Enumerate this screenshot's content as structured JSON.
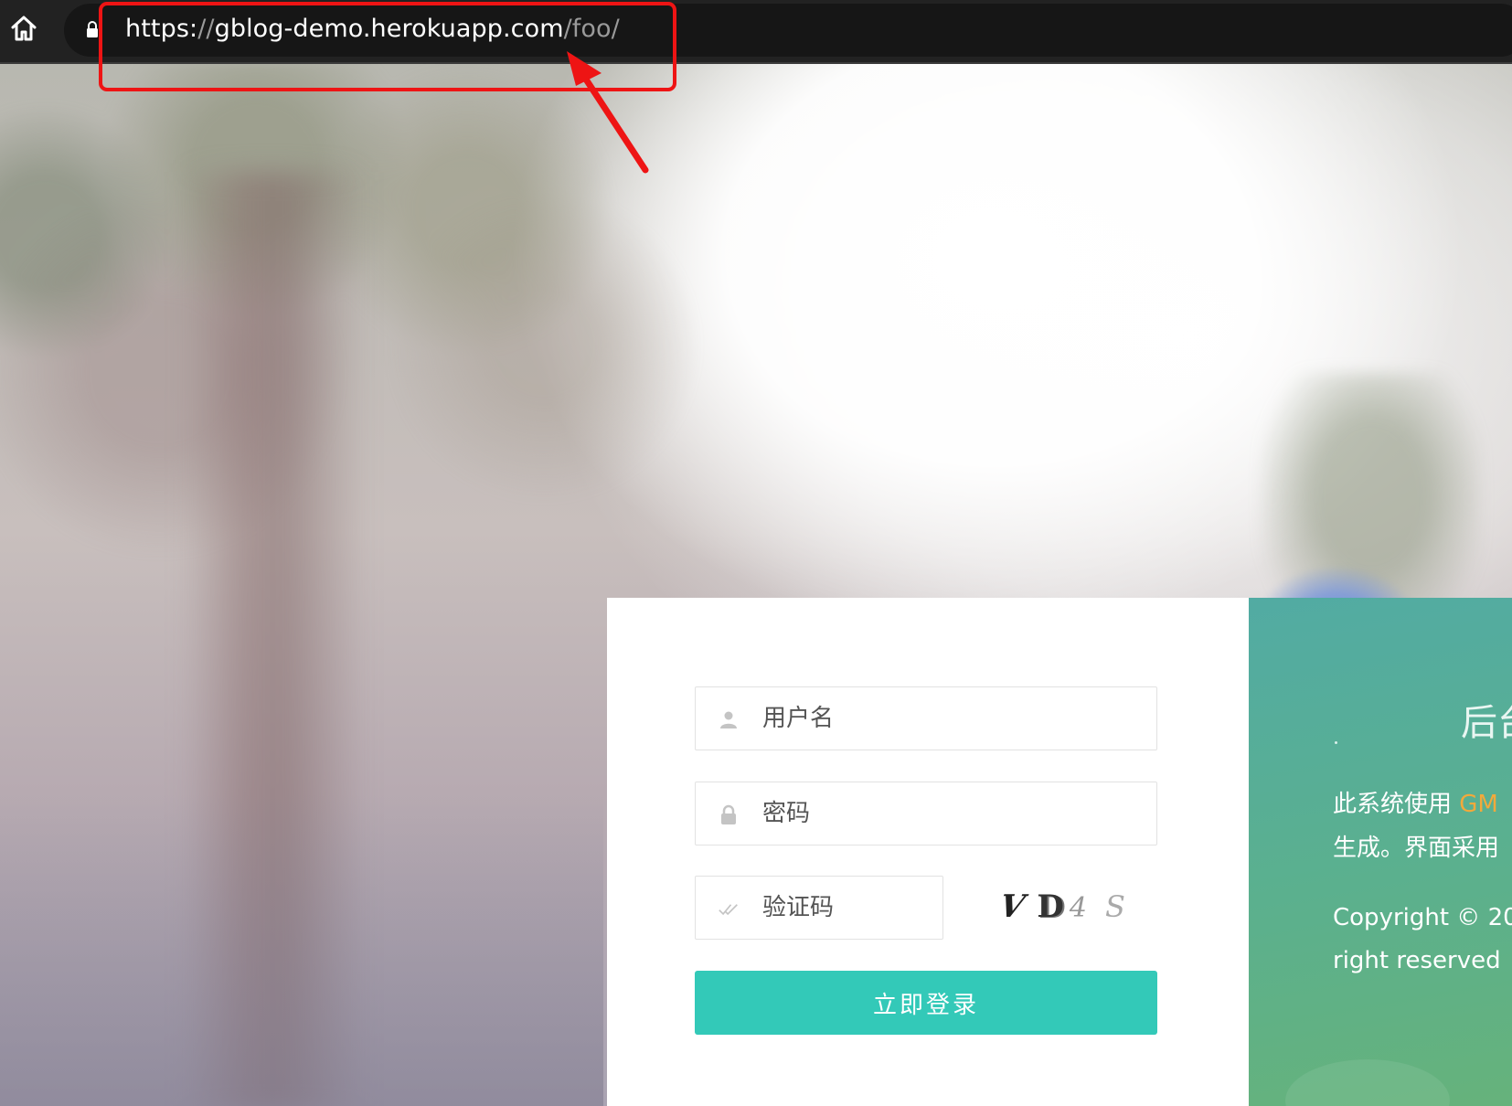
{
  "browser": {
    "url": {
      "scheme": "https:",
      "separator": "//",
      "host": "gblog-demo.herokuapp.com",
      "path": "/foo/"
    },
    "highlight_color": "#ee1414"
  },
  "login": {
    "username_placeholder": "用户名",
    "password_placeholder": "密码",
    "captcha_placeholder": "验证码",
    "captcha_chars": [
      "V",
      "D",
      "4",
      "S"
    ],
    "submit_label": "立即登录",
    "accent_color": "#33c9b8"
  },
  "info": {
    "title": "后台",
    "line1_prefix": "此系统使用 ",
    "line1_link": "GM",
    "line2": "生成。界面采用",
    "line3": "Copyright © 20",
    "line4": "right reserved"
  }
}
